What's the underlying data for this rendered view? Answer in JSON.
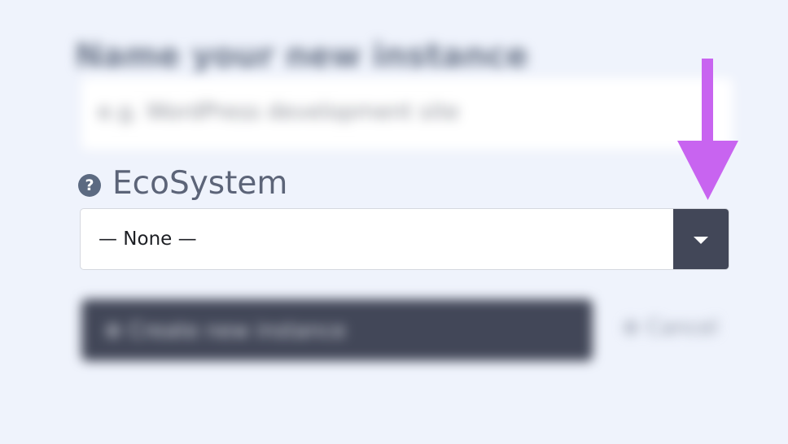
{
  "form": {
    "name_label": "Name your new instance",
    "name_placeholder": "e.g. WordPress development site",
    "ecosystem_label": "EcoSystem",
    "ecosystem_help_icon": "question-circle-icon",
    "ecosystem_selected": "— None —",
    "dropdown_icon": "caret-down-icon",
    "create_button_label": "⊕  Create new instance",
    "cancel_label": "⊗ Cancel"
  },
  "annotation": {
    "arrow_color": "#c864f0",
    "arrow_direction": "down"
  },
  "colors": {
    "background": "#eff3fc",
    "dark_button": "#424758",
    "label": "#5c6478"
  }
}
